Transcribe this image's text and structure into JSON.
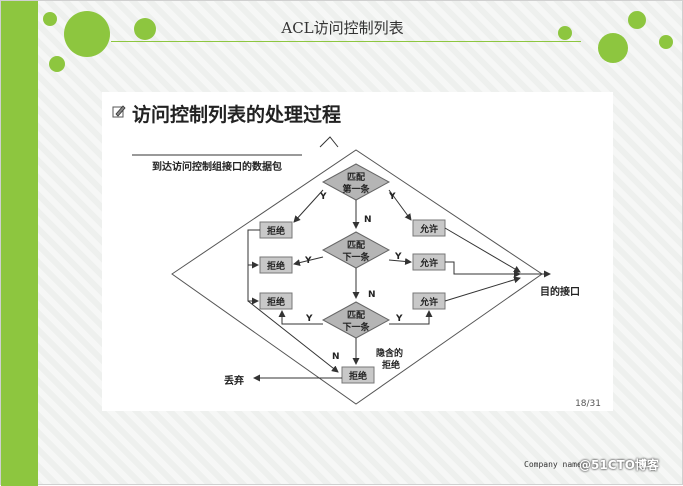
{
  "slide": {
    "title": "ACL访问控制列表",
    "colors": {
      "accent": "#8dc63f",
      "box": "#c8c8c8",
      "diamond": "#b5b5b5"
    },
    "footer": "Company name",
    "watermark": "@51CTO博客"
  },
  "panel": {
    "icon": "pencil-icon",
    "heading": "访问控制列表的处理过程",
    "page": "18/31"
  },
  "flow": {
    "entry": "到达访问控制组接口的数据包",
    "match1": [
      "匹配",
      "第一条"
    ],
    "match2": [
      "匹配",
      "下一条"
    ],
    "match3": [
      "匹配",
      "下一条"
    ],
    "deny": "拒绝",
    "permit": "允许",
    "yes": "Y",
    "no": "N",
    "implicit_deny": [
      "隐含的",
      "拒绝"
    ],
    "destination": "目的接口",
    "discard": "丢弃"
  }
}
